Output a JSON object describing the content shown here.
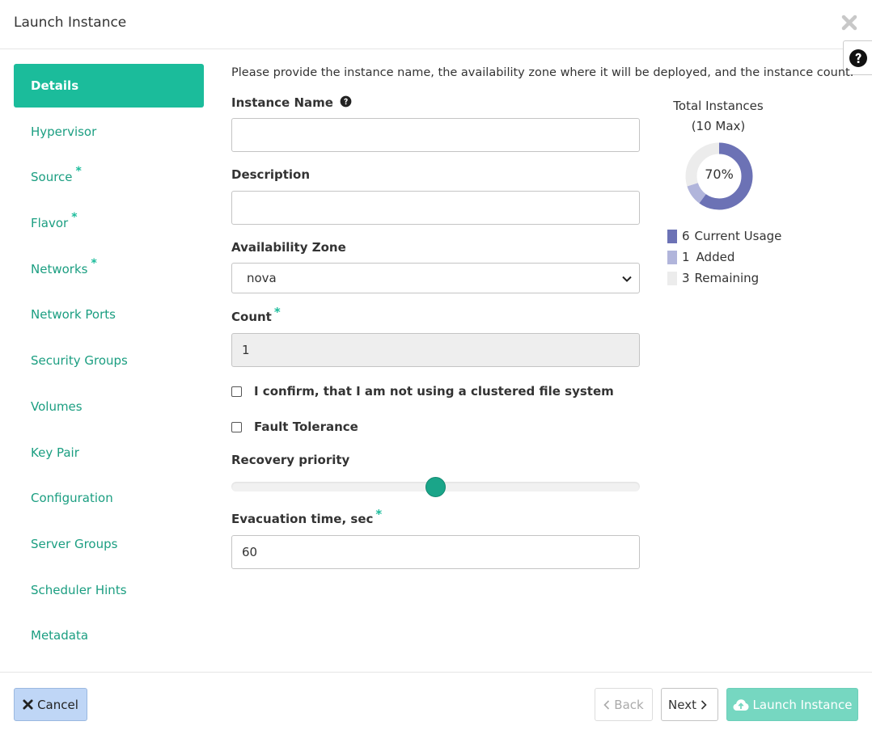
{
  "modal": {
    "title": "Launch Instance",
    "close_icon": "close-icon",
    "help_icon": "question-circle-icon"
  },
  "sidebar": {
    "items": [
      {
        "label": "Details",
        "required": false,
        "active": true
      },
      {
        "label": "Hypervisor",
        "required": false,
        "active": false
      },
      {
        "label": "Source",
        "required": true,
        "active": false
      },
      {
        "label": "Flavor",
        "required": true,
        "active": false
      },
      {
        "label": "Networks",
        "required": true,
        "active": false
      },
      {
        "label": "Network Ports",
        "required": false,
        "active": false
      },
      {
        "label": "Security Groups",
        "required": false,
        "active": false
      },
      {
        "label": "Volumes",
        "required": false,
        "active": false
      },
      {
        "label": "Key Pair",
        "required": false,
        "active": false
      },
      {
        "label": "Configuration",
        "required": false,
        "active": false
      },
      {
        "label": "Server Groups",
        "required": false,
        "active": false
      },
      {
        "label": "Scheduler Hints",
        "required": false,
        "active": false
      },
      {
        "label": "Metadata",
        "required": false,
        "active": false
      }
    ],
    "required_mark": "*"
  },
  "form": {
    "intro": "Please provide the instance name, the availability zone where it will be deployed, and the instance count.",
    "instance_name": {
      "label": "Instance Name",
      "value": "",
      "help_icon": "question-circle-icon"
    },
    "description": {
      "label": "Description",
      "value": ""
    },
    "availability_zone": {
      "label": "Availability Zone",
      "selected": "nova"
    },
    "count": {
      "label": "Count",
      "value": "1",
      "required_mark": "*"
    },
    "confirm_checkbox": {
      "label": "I confirm, that I am not using a clustered file system",
      "checked": false
    },
    "fault_tolerance": {
      "label": "Fault Tolerance",
      "checked": false
    },
    "recovery_priority": {
      "label": "Recovery priority",
      "level": 0.5
    },
    "evacuation_time": {
      "label": "Evacuation time, sec",
      "value": "60",
      "required_mark": "*"
    }
  },
  "quota": {
    "title_line1": "Total Instances",
    "title_line2": "(10 Max)",
    "percent_label": "70%",
    "max": 10,
    "colors": {
      "current": "#6c72b5",
      "added": "#b1b5db",
      "remaining": "#ececec"
    },
    "legend": [
      {
        "count": "6",
        "label": "Current Usage"
      },
      {
        "count": "1",
        "label": "Added"
      },
      {
        "count": "3",
        "label": "Remaining"
      }
    ]
  },
  "chart_data": {
    "type": "pie",
    "title": "Total Instances",
    "categories": [
      "Current Usage",
      "Added",
      "Remaining"
    ],
    "values": [
      6,
      1,
      3
    ],
    "center_label": "70%"
  },
  "footer": {
    "cancel_label": "Cancel",
    "back_label": "Back",
    "next_label": "Next",
    "launch_label": "Launch Instance"
  }
}
